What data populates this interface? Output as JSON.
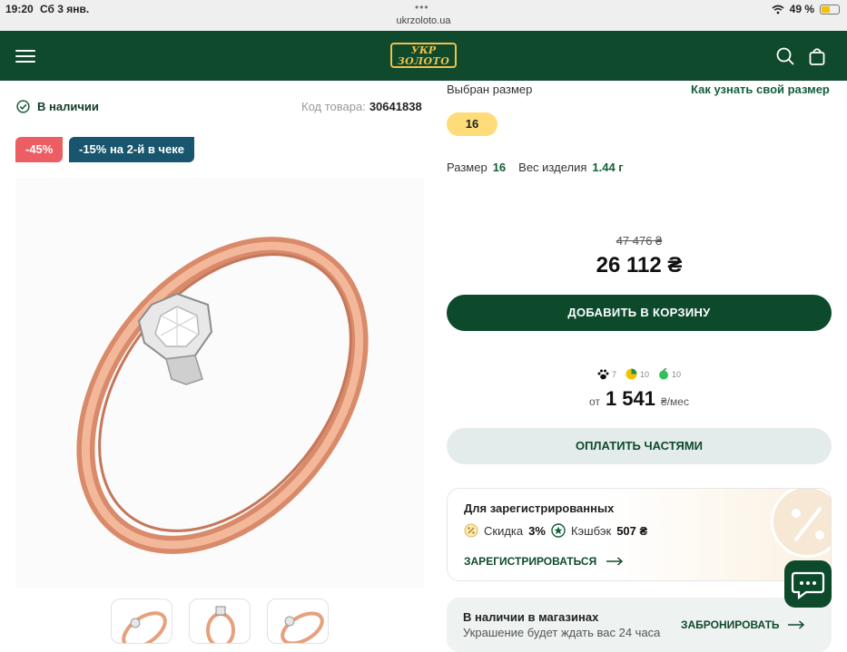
{
  "status_bar": {
    "time": "19:20",
    "date": "Сб 3 янв.",
    "menu_dots": "•••",
    "url": "ukrzoloto.ua",
    "battery": "49 %",
    "battery_level": 0.49
  },
  "header": {
    "logo_line1": "УКР",
    "logo_line2": "ЗОЛОТО",
    "brand_color": "#0f4a2c",
    "accent_color": "#f0c14b"
  },
  "product": {
    "availability": "В наличии",
    "sku_label": "Код товара:",
    "sku": "30641838",
    "badges": [
      "-45%",
      "-15% на 2-й в чеке"
    ]
  },
  "size": {
    "selected_label": "Выбран размер",
    "how_to_link": "Как узнать свой размер",
    "selected": "16",
    "size_label": "Размер",
    "size_value": "16",
    "weight_label": "Вес изделия",
    "weight_value": "1.44 г"
  },
  "price": {
    "old": "47 476 ₴",
    "new": "26 112 ₴",
    "add_to_cart": "ДОБАВИТЬ В КОРЗИНУ"
  },
  "installments": {
    "partners": [
      {
        "icon": "paw-icon",
        "count": "7",
        "color": "#111111"
      },
      {
        "icon": "pie-icon",
        "count": "10",
        "color": "#f2c200"
      },
      {
        "icon": "apple-icon",
        "count": "10",
        "color": "#33c05a"
      }
    ],
    "prefix": "от",
    "amount": "1 541",
    "suffix": "₴/мес",
    "pay_button": "ОПЛАТИТЬ ЧАСТЯМИ"
  },
  "registered": {
    "title": "Для зарегистрированных",
    "discount_label": "Скидка",
    "discount_value": "3%",
    "cashback_label": "Кэшбэк",
    "cashback_value": "507 ₴",
    "register_link": "ЗАРЕГИСТРИРОВАТЬСЯ"
  },
  "stores": {
    "title": "В наличии в магазинах",
    "subtitle": "Украшение будет ждать вас 24 часа",
    "reserve_link": "ЗАБРОНИРОВАТЬ"
  }
}
